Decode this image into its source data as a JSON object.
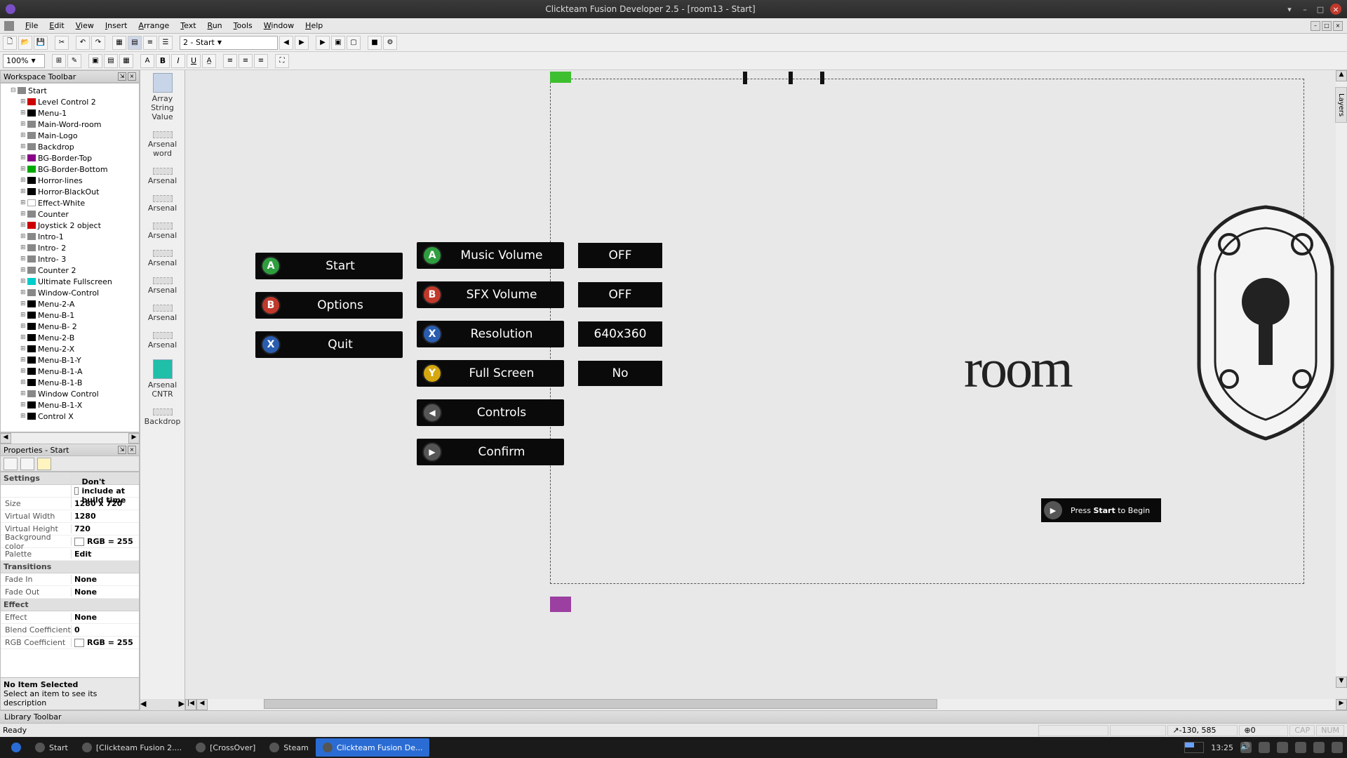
{
  "window": {
    "title": "Clickteam Fusion Developer 2.5 - [room13 - Start]"
  },
  "menus": [
    "File",
    "Edit",
    "View",
    "Insert",
    "Arrange",
    "Text",
    "Run",
    "Tools",
    "Window",
    "Help"
  ],
  "toolbar2": {
    "zoom": "100%",
    "frame_combo": "2 - Start"
  },
  "workspace": {
    "title": "Workspace Toolbar",
    "root": "Start",
    "items": [
      {
        "label": "Level Control 2",
        "c": "red"
      },
      {
        "label": "Menu-1",
        "c": "black"
      },
      {
        "label": "Main-Word-room",
        "c": "gray"
      },
      {
        "label": "Main-Logo",
        "c": "gray"
      },
      {
        "label": "Backdrop",
        "c": "gray"
      },
      {
        "label": "BG-Border-Top",
        "c": "purple"
      },
      {
        "label": "BG-Border-Bottom",
        "c": "green"
      },
      {
        "label": "Horror-lines",
        "c": "black"
      },
      {
        "label": "Horror-BlackOut",
        "c": "black"
      },
      {
        "label": "Effect-White",
        "c": "white"
      },
      {
        "label": "Counter",
        "c": "gray"
      },
      {
        "label": "Joystick 2 object",
        "c": "red"
      },
      {
        "label": "Intro-1",
        "c": "gray"
      },
      {
        "label": "Intro- 2",
        "c": "gray"
      },
      {
        "label": "Intro- 3",
        "c": "gray"
      },
      {
        "label": "Counter 2",
        "c": "gray"
      },
      {
        "label": "Ultimate Fullscreen",
        "c": "cyan"
      },
      {
        "label": "Window-Control",
        "c": "gray"
      },
      {
        "label": "Menu-2-A",
        "c": "black"
      },
      {
        "label": "Menu-B-1",
        "c": "black"
      },
      {
        "label": "Menu-B- 2",
        "c": "black"
      },
      {
        "label": "Menu-2-B",
        "c": "black"
      },
      {
        "label": "Menu-2-X",
        "c": "black"
      },
      {
        "label": "Menu-B-1-Y",
        "c": "black"
      },
      {
        "label": "Menu-B-1-A",
        "c": "black"
      },
      {
        "label": "Menu-B-1-B",
        "c": "black"
      },
      {
        "label": "Window Control",
        "c": "gray"
      },
      {
        "label": "Menu-B-1-X",
        "c": "black"
      },
      {
        "label": "Control X",
        "c": "black"
      }
    ]
  },
  "properties": {
    "title": "Properties - Start",
    "section1": "Settings",
    "rows": [
      {
        "name": "",
        "val": "Don't include at build time",
        "chk": true
      },
      {
        "name": "Size",
        "val": "1280 x 720"
      },
      {
        "name": "Virtual Width",
        "val": "1280"
      },
      {
        "name": "Virtual Height",
        "val": "720"
      },
      {
        "name": "Background color",
        "val": "RGB = 255",
        "swatch": true
      },
      {
        "name": "Palette",
        "val": "Edit",
        "btn": true
      }
    ],
    "section2": "Transitions",
    "rows2": [
      {
        "name": "Fade In",
        "val": "None"
      },
      {
        "name": "Fade Out",
        "val": "None"
      }
    ],
    "section3": "Effect",
    "rows3": [
      {
        "name": "Effect",
        "val": "None"
      },
      {
        "name": "Blend Coefficient",
        "val": "0"
      },
      {
        "name": "RGB Coefficient",
        "val": "RGB = 255",
        "swatch": true
      }
    ],
    "footer_title": "No Item Selected",
    "footer_text": "Select an item to see its description"
  },
  "obj_strip": [
    {
      "label": "Array String Value",
      "big": true
    },
    {
      "label": "Arsenal word"
    },
    {
      "label": "Arsenal"
    },
    {
      "label": "Arsenal"
    },
    {
      "label": "Arsenal"
    },
    {
      "label": "Arsenal"
    },
    {
      "label": "Arsenal"
    },
    {
      "label": "Arsenal"
    },
    {
      "label": "Arsenal"
    },
    {
      "label": "Arsenal CNTR",
      "teal": true
    },
    {
      "label": "Backdrop"
    }
  ],
  "game": {
    "left_menu": [
      {
        "btn": "A",
        "label": "Start"
      },
      {
        "btn": "B",
        "label": "Options"
      },
      {
        "btn": "X",
        "label": "Quit"
      }
    ],
    "mid_menu": [
      {
        "btn": "A",
        "label": "Music Volume",
        "val": "OFF"
      },
      {
        "btn": "B",
        "label": "SFX Volume",
        "val": "OFF"
      },
      {
        "btn": "X",
        "label": "Resolution",
        "val": "640x360"
      },
      {
        "btn": "Y",
        "label": "Full Screen",
        "val": "No"
      },
      {
        "btn": "◀",
        "label": "Controls"
      },
      {
        "btn": "▶",
        "label": "Confirm"
      }
    ],
    "logo_text": "room",
    "press_pre": "Press ",
    "press_bold": "Start",
    "press_post": " to Begin"
  },
  "layers_tab": "Layers",
  "library": "Library Toolbar",
  "status": {
    "ready": "Ready",
    "coords": "-130, 585",
    "zero": "0",
    "cap": "CAP",
    "num": "NUM"
  },
  "taskbar": {
    "items": [
      {
        "label": "Start"
      },
      {
        "label": "[Clickteam Fusion 2...."
      },
      {
        "label": "[CrossOver]"
      },
      {
        "label": "Steam"
      },
      {
        "label": "Clickteam Fusion De...",
        "active": true
      }
    ],
    "time": "13:25"
  }
}
